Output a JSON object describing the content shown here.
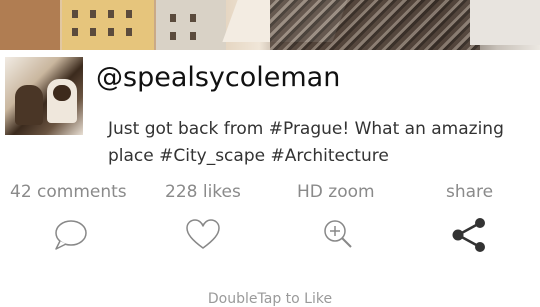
{
  "post": {
    "username": "@spealsycoleman",
    "message": "Just got back from #Prague! What an amazing place #City_scape #Architecture"
  },
  "stats": {
    "comments": "42 comments",
    "likes": "228 likes",
    "zoom": "HD zoom",
    "share": "share"
  },
  "icons": {
    "comment": "speech-bubble-icon",
    "like": "heart-icon",
    "zoom": "zoom-in-icon",
    "share": "share-icon"
  },
  "footer": {
    "hint": "DoubleTap to Like"
  },
  "colors": {
    "text_primary": "#111111",
    "text_muted": "#8a8a8a",
    "icon": "#888888",
    "share_icon": "#333333"
  }
}
